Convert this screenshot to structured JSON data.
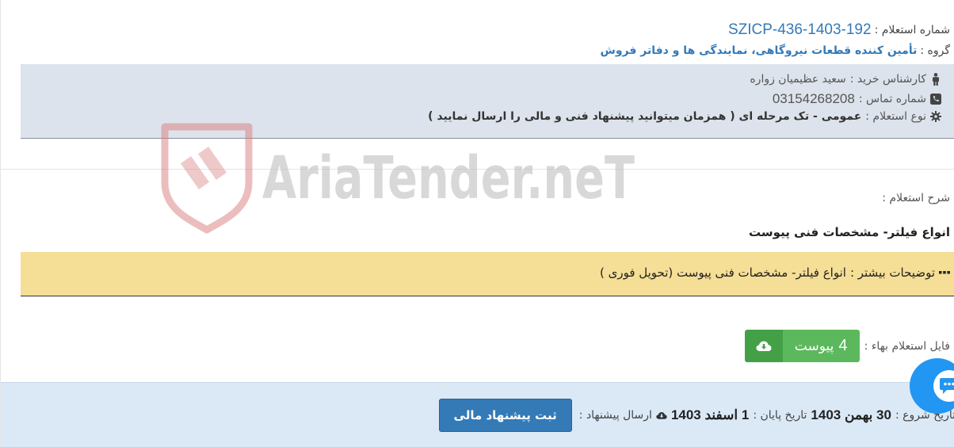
{
  "tender": {
    "number_label": "شماره استعلام :",
    "number_value": "SZICP-436-1403-192",
    "group_label": "گروه :",
    "group_value": "تأمین کننده قطعات نیروگاهی، نمایندگی ها و دفاتر فروش"
  },
  "info": {
    "expert_label": "کارشناس خرید :",
    "expert_value": "سعید عظیمیان زواره",
    "phone_label": "شماره تماس :",
    "phone_value": "03154268208",
    "type_label": "نوع استعلام :",
    "type_value": "عمومی - تک مرحله ای ( همزمان میتوانید پیشنهاد فنی و مالی را ارسال نمایید )"
  },
  "watermark": {
    "text": "AriaTender.neT"
  },
  "description": {
    "label": "شرح استعلام :",
    "title": "انواع فیلتر- مشخصات فنی پیوست"
  },
  "more": {
    "label": "توضیحات بیشتر :",
    "value": "انواع فیلتر- مشخصات فنی پیوست (تحویل فوری )"
  },
  "file": {
    "label": "فایل استعلام بهاء :",
    "count": "4",
    "button_text": "پیوست"
  },
  "bottom": {
    "start_label": "تاریخ شروع :",
    "start_date": "30 بهمن 1403",
    "end_label": "تاریخ پایان :",
    "end_date": "1 اسفند 1403",
    "send_label": "ارسال پیشنهاد :",
    "submit_label": "ثبت پیشنهاد مالی"
  },
  "colors": {
    "accent": "#337ab7",
    "info_bg": "#dde3ec",
    "more_bg": "#f5de96",
    "success": "#5cb85c",
    "bottom_bg": "#dbe9f7",
    "chat": "#2196f3"
  },
  "icons": [
    "person-icon",
    "phone-icon",
    "gear-icon",
    "ellipsis-icon",
    "cloud-download-icon",
    "chat-icon"
  ]
}
